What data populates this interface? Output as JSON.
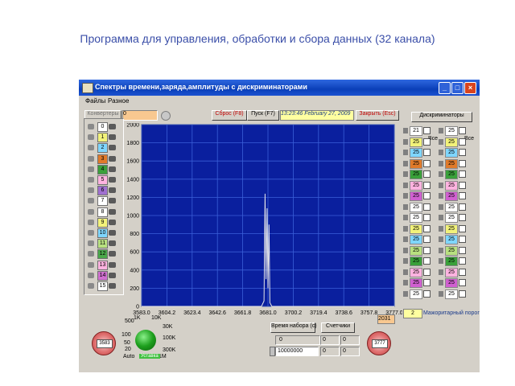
{
  "slide": {
    "title": "Программа для управления, обработки и сбора данных (32 канала)"
  },
  "window": {
    "title": "Спектры времени,заряда,амплитуды с дискриминаторами",
    "menu": [
      "Файлы",
      "Разное"
    ]
  },
  "toolbar": {
    "converters_label": "Конвертеры",
    "input_value": "0",
    "reset_label": "Сброс (F8)",
    "start_label": "Пуск (F7)",
    "datetime": "13:23:46  February 27, 2009",
    "close_label": "Закрыть (Esc)"
  },
  "channels": [
    {
      "n": "0",
      "color": "#ffffff"
    },
    {
      "n": "1",
      "color": "#f2f27a"
    },
    {
      "n": "2",
      "color": "#7fd6ff"
    },
    {
      "n": "3",
      "color": "#e07a2a"
    },
    {
      "n": "4",
      "color": "#3aa03a"
    },
    {
      "n": "5",
      "color": "#ffb3e0"
    },
    {
      "n": "6",
      "color": "#a070d0"
    },
    {
      "n": "7",
      "color": "#ffffff"
    },
    {
      "n": "8",
      "color": "#ffffff"
    },
    {
      "n": "9",
      "color": "#f2f27a"
    },
    {
      "n": "10",
      "color": "#7fd6ff"
    },
    {
      "n": "11",
      "color": "#b8e080"
    },
    {
      "n": "12",
      "color": "#4aa84a"
    },
    {
      "n": "13",
      "color": "#ffb3e0"
    },
    {
      "n": "14",
      "color": "#d070d0"
    },
    {
      "n": "15",
      "color": "#ffffff"
    }
  ],
  "discriminators": {
    "title": "Дискриминаторы",
    "all_label": "Все",
    "values": [
      {
        "v": "21",
        "color": "#ffffff"
      },
      {
        "v": "25",
        "color": "#f2f27a"
      },
      {
        "v": "25",
        "color": "#7fd6ff"
      },
      {
        "v": "25",
        "color": "#e07a2a"
      },
      {
        "v": "25",
        "color": "#3aa03a"
      },
      {
        "v": "25",
        "color": "#ffb3e0"
      },
      {
        "v": "25",
        "color": "#d060d0"
      },
      {
        "v": "25",
        "color": "#ffffff"
      },
      {
        "v": "25",
        "color": "#ffffff"
      },
      {
        "v": "25",
        "color": "#f2f27a"
      },
      {
        "v": "25",
        "color": "#7fd6ff"
      },
      {
        "v": "25",
        "color": "#b8e080"
      },
      {
        "v": "25",
        "color": "#3aa03a"
      },
      {
        "v": "25",
        "color": "#ffb3e0"
      },
      {
        "v": "25",
        "color": "#d060d0"
      },
      {
        "v": "25",
        "color": "#ffffff"
      }
    ],
    "values_right": [
      {
        "v": "25",
        "color": "#ffffff"
      },
      {
        "v": "25",
        "color": "#f2f27a"
      },
      {
        "v": "25",
        "color": "#7fd6ff"
      },
      {
        "v": "25",
        "color": "#e07a2a"
      },
      {
        "v": "25",
        "color": "#3aa03a"
      },
      {
        "v": "25",
        "color": "#ffb3e0"
      },
      {
        "v": "25",
        "color": "#d060d0"
      },
      {
        "v": "25",
        "color": "#ffffff"
      },
      {
        "v": "25",
        "color": "#ffffff"
      },
      {
        "v": "25",
        "color": "#f2f27a"
      },
      {
        "v": "25",
        "color": "#7fd6ff"
      },
      {
        "v": "25",
        "color": "#b8e080"
      },
      {
        "v": "25",
        "color": "#3aa03a"
      },
      {
        "v": "25",
        "color": "#ffb3e0"
      },
      {
        "v": "25",
        "color": "#d060d0"
      },
      {
        "v": "25",
        "color": "#ffffff"
      }
    ],
    "majority_value": "2",
    "majority_label": "Мажоритарный порог"
  },
  "chart_data": {
    "type": "line",
    "y_ticks": [
      "2000",
      "1800",
      "1600",
      "1400",
      "1200",
      "1000",
      "800",
      "600",
      "400",
      "200",
      "0"
    ],
    "x_ticks": [
      "3583.0",
      "3604.2",
      "3623.4",
      "3642.6",
      "3661.8",
      "3681.0",
      "3700.2",
      "3719.4",
      "3738.6",
      "3757.8",
      "3777.0"
    ],
    "xlim": [
      3583.0,
      3777.0
    ],
    "ylim": [
      0,
      2000
    ],
    "grid": true,
    "background": "#0a1f9e",
    "line_color": "#e8e8e8",
    "series": [
      {
        "x": [
          3583.0,
          3675.0,
          3677.0,
          3677.8,
          3678.5,
          3679.3,
          3680.0,
          3680.8,
          3681.5,
          3683.0,
          3777.0
        ],
        "y": [
          0,
          0,
          60,
          1240,
          300,
          1080,
          200,
          900,
          40,
          0,
          0
        ]
      }
    ]
  },
  "bottom": {
    "knob_left_value": "3583",
    "knob_right_value": "3777",
    "range_value": "2031",
    "scale_labels": [
      "500",
      "100",
      "50",
      "20",
      "1K",
      "10K",
      "30K",
      "100K",
      "300K",
      "1M"
    ],
    "auto_label": "Auto",
    "green_label": "Уставка",
    "time_label": "Время набора (с)",
    "time_value1": "0",
    "time_value2": "10000000",
    "counter_label": "Счетчики",
    "counters": [
      "0",
      "0",
      "0",
      "0"
    ]
  }
}
